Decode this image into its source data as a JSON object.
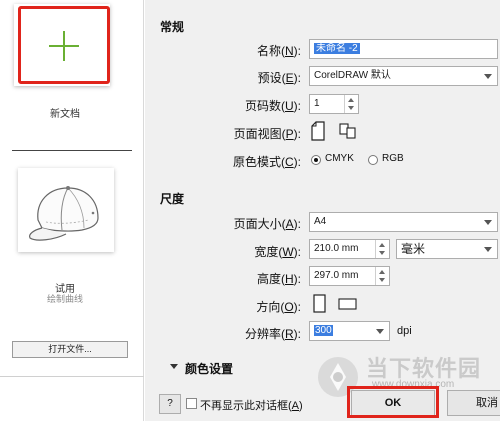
{
  "left_pane": {
    "new_doc_label": "新文档",
    "trial_label": "试用",
    "trial_sub_label": "绘制曲线",
    "open_file_label": "打开文件..."
  },
  "general": {
    "section_title": "常规",
    "name_label": "名称(",
    "name_key": "N",
    "name_value": "未命名 -2",
    "preset_label": "预设(",
    "preset_key": "E",
    "preset_value": "CorelDRAW 默认",
    "pages_label": "页码数(",
    "pages_key": "U",
    "pages_value": "1",
    "page_view_label": "页面视图(",
    "page_view_key": "P",
    "color_mode_label": "原色模式(",
    "color_mode_key": "C",
    "color_options": [
      "CMYK",
      "RGB"
    ],
    "color_selected": "CMYK"
  },
  "dimensions": {
    "section_title": "尺度",
    "size_label": "页面大小(",
    "size_key": "A",
    "size_value": "A4",
    "width_label": "宽度(",
    "width_key": "W",
    "width_value": "210.0 mm",
    "unit_value": "毫米",
    "height_label": "高度(",
    "height_key": "H",
    "height_value": "297.0 mm",
    "orientation_label": "方向(",
    "orientation_key": "O",
    "resolution_label": "分辨率(",
    "resolution_key": "R",
    "resolution_value": "300",
    "resolution_unit": "dpi"
  },
  "color_settings_label": "颜色设置",
  "footer": {
    "help_label": "?",
    "dont_show_label": "不再显示此对话框(",
    "dont_show_key": "A",
    "ok_label": "OK",
    "cancel_label": "取消"
  },
  "watermark": {
    "text": "当下软件园",
    "url": "www.downxia.com"
  },
  "colors": {
    "highlight_frame": "#e0241b",
    "plus_green": "#6ab033",
    "selection_blue": "#3c7ee0"
  }
}
